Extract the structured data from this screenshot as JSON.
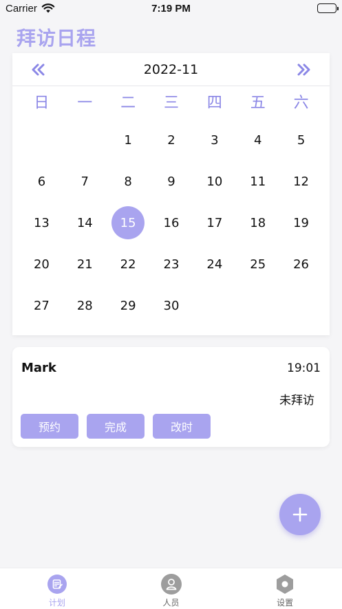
{
  "status_bar": {
    "carrier": "Carrier",
    "time": "7:19 PM"
  },
  "page": {
    "title": "拜访日程"
  },
  "calendar": {
    "month": "2022-11",
    "weekdays": [
      "日",
      "一",
      "二",
      "三",
      "四",
      "五",
      "六"
    ],
    "leading_blanks": 2,
    "days": [
      "1",
      "2",
      "3",
      "4",
      "5",
      "6",
      "7",
      "8",
      "9",
      "10",
      "11",
      "12",
      "13",
      "14",
      "15",
      "16",
      "17",
      "18",
      "19",
      "20",
      "21",
      "22",
      "23",
      "24",
      "25",
      "26",
      "27",
      "28",
      "29",
      "30"
    ],
    "selected_day": "15"
  },
  "visit": {
    "name": "Mark",
    "time": "19:01",
    "status": "未拜访",
    "actions": {
      "book": "预约",
      "done": "完成",
      "reschedule": "改时"
    }
  },
  "fab": {
    "icon": "plus-icon"
  },
  "tab_bar": {
    "items": [
      {
        "label": "计划",
        "icon": "plan-icon"
      },
      {
        "label": "人员",
        "icon": "person-icon"
      },
      {
        "label": "设置",
        "icon": "settings-icon"
      }
    ]
  },
  "colors": {
    "accent": "#a9a4ef",
    "accent_dark": "#8b87e6",
    "inactive": "#999999"
  }
}
